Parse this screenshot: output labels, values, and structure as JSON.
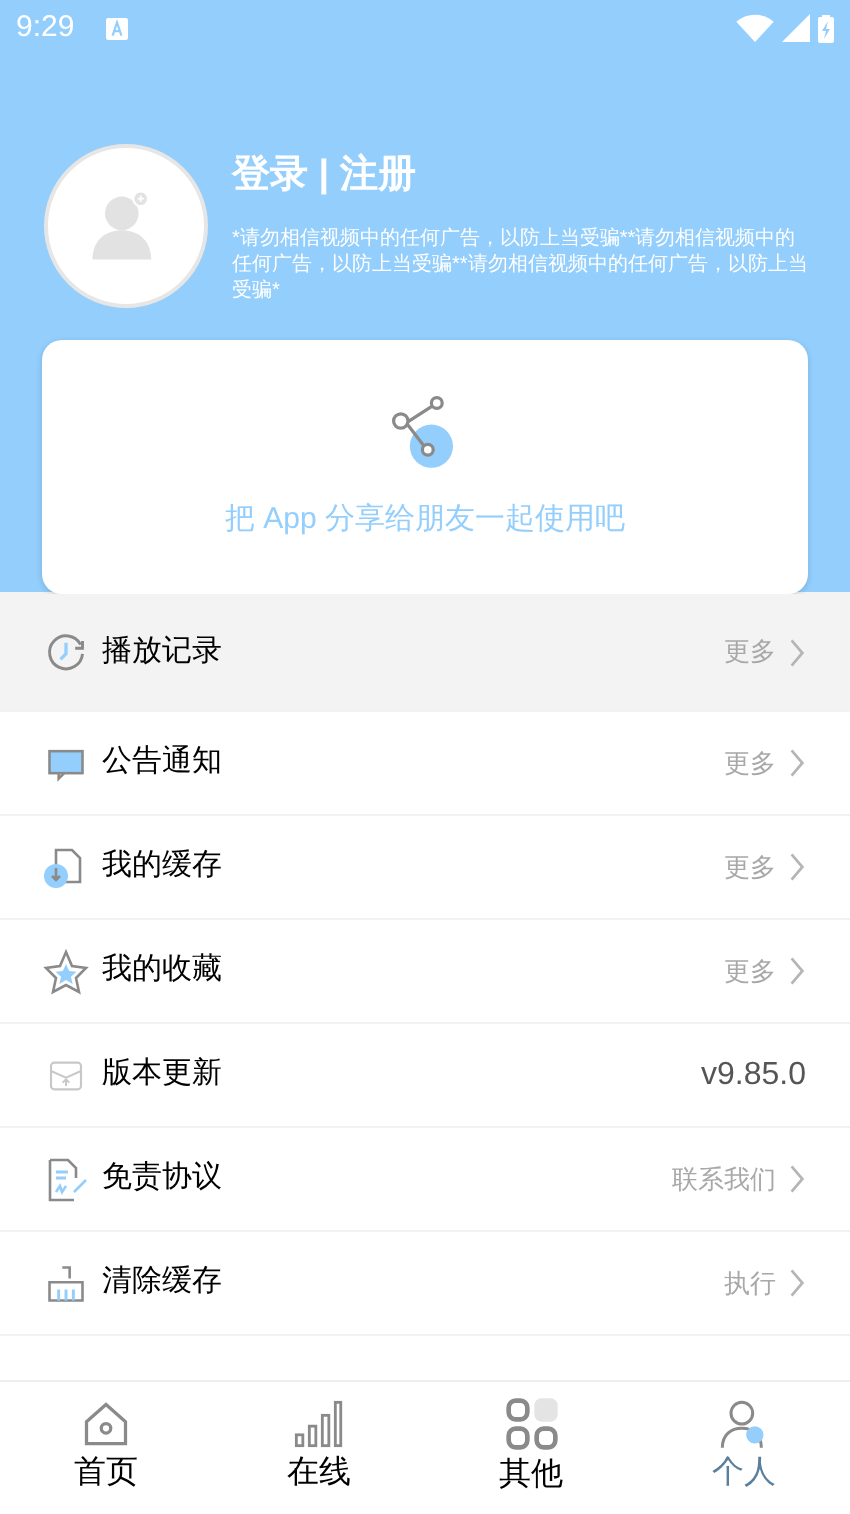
{
  "status_bar": {
    "time": "9:29"
  },
  "profile": {
    "title": "登录 | 注册",
    "notice": "*请勿相信视频中的任何广告，以防上当受骗**请勿相信视频中的任何广告，以防上当受骗**请勿相信视频中的任何广告，以防上当受骗*"
  },
  "share_card": {
    "text": "把 App 分享给朋友一起使用吧"
  },
  "menu": [
    {
      "label": "播放记录",
      "action": "更多",
      "kind": "link"
    },
    {
      "label": "公告通知",
      "action": "更多",
      "kind": "link"
    },
    {
      "label": "我的缓存",
      "action": "更多",
      "kind": "link"
    },
    {
      "label": "我的收藏",
      "action": "更多",
      "kind": "link"
    },
    {
      "label": "版本更新",
      "action": "v9.85.0",
      "kind": "value"
    },
    {
      "label": "免责协议",
      "action": "联系我们",
      "kind": "link"
    },
    {
      "label": "清除缓存",
      "action": "执行",
      "kind": "link"
    }
  ],
  "nav": [
    {
      "label": "首页",
      "selected": false
    },
    {
      "label": "在线",
      "selected": false
    },
    {
      "label": "其他",
      "selected": false
    },
    {
      "label": "个人",
      "selected": true
    }
  ]
}
